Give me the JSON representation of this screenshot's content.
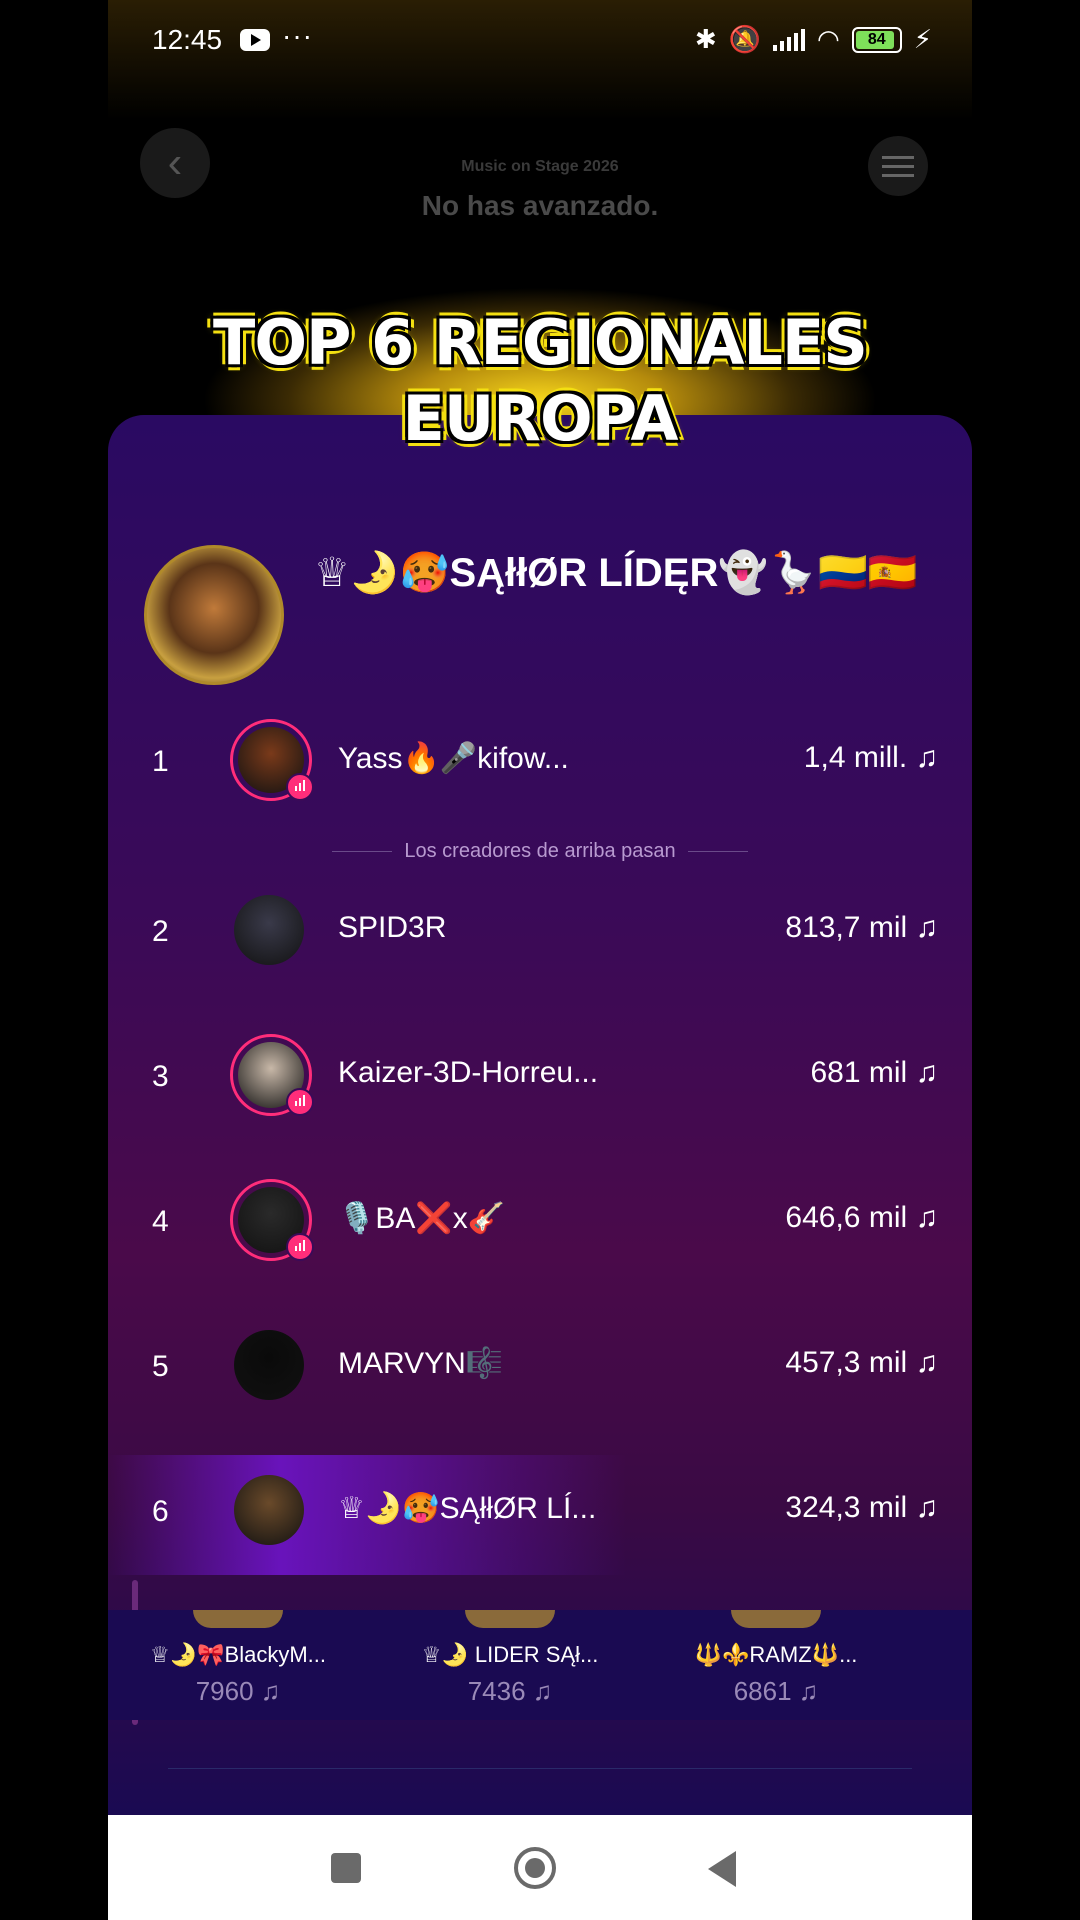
{
  "status_bar": {
    "time": "12:45",
    "dots": "···",
    "battery": "84"
  },
  "header": {
    "event_subtitle": "Music on Stage 2026",
    "event_title": "No has avanzado."
  },
  "overlay": {
    "line1": "TOP 6 REGIONALES",
    "line2": "EUROPA"
  },
  "team": {
    "name": "♕🌛🥵SĄłłØR LÍDĘR👻🪿🇨🇴🇪🇸"
  },
  "ranking": [
    {
      "rank": "1",
      "name": "Yass🔥🎤kifow...",
      "score": "1,4 mill. ♫",
      "live": true,
      "color": "#7a3a1a"
    },
    {
      "rank": "2",
      "name": "SPID3R",
      "score": "813,7 mil ♫",
      "live": false,
      "color": "#3a3a4a"
    },
    {
      "rank": "3",
      "name": "Kaizer-3D-Horreu...",
      "score": "681 mil ♫",
      "live": true,
      "color": "#c8b8a8"
    },
    {
      "rank": "4",
      "name": "🎙️BA❌x🎸",
      "score": "646,6 mil ♫",
      "live": true,
      "color": "#2a2a2a"
    },
    {
      "rank": "5",
      "name": "MARVYN🎼",
      "score": "457,3 mil ♫",
      "live": false,
      "color": "#0a0a0a"
    },
    {
      "rank": "6",
      "name": "♕🌛🥵SĄłłØR LÍ...",
      "score": "324,3 mil ♫",
      "live": false,
      "color": "#6a4a2a"
    }
  ],
  "divider_text": "Los creadores de arriba pasan",
  "sub_ranking": [
    {
      "name": "♕🌛🎀BlackyM...",
      "value": "7960  ♫"
    },
    {
      "name": "♕🌛 LIDER SĄł...",
      "value": "7436  ♫"
    },
    {
      "name": "🔱⚜️RAMZ🔱...",
      "value": "6861  ♫"
    }
  ]
}
